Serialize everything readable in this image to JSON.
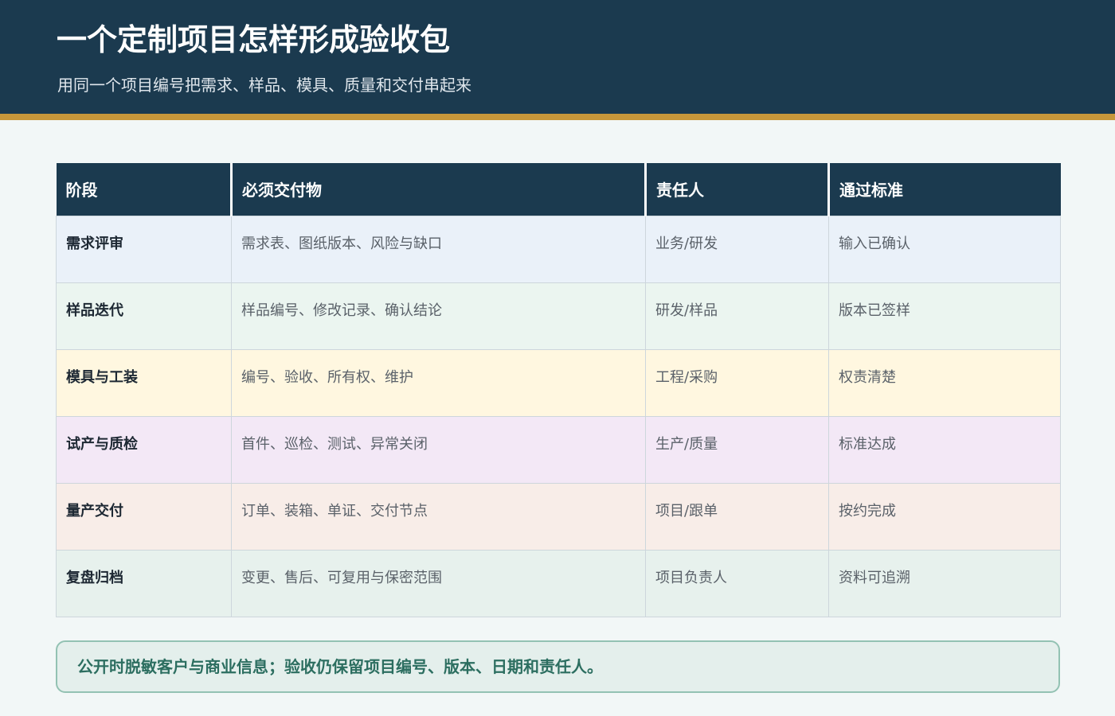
{
  "header": {
    "title": "一个定制项目怎样形成验收包",
    "subtitle": "用同一个项目编号把需求、样品、模具、质量和交付串起来"
  },
  "table": {
    "headers": [
      "阶段",
      "必须交付物",
      "责任人",
      "通过标准"
    ],
    "rows": [
      {
        "stage": "需求评审",
        "deliverables": "需求表、图纸版本、风险与缺口",
        "owner": "业务/研发",
        "criteria": "输入已确认",
        "color": "#eaf1f9"
      },
      {
        "stage": "样品迭代",
        "deliverables": "样品编号、修改记录、确认结论",
        "owner": "研发/样品",
        "criteria": "版本已签样",
        "color": "#ebf5f0"
      },
      {
        "stage": "模具与工装",
        "deliverables": "编号、验收、所有权、维护",
        "owner": "工程/采购",
        "criteria": "权责清楚",
        "color": "#fff7e0"
      },
      {
        "stage": "试产与质检",
        "deliverables": "首件、巡检、测试、异常关闭",
        "owner": "生产/质量",
        "criteria": "标准达成",
        "color": "#f3e8f6"
      },
      {
        "stage": "量产交付",
        "deliverables": "订单、装箱、单证、交付节点",
        "owner": "项目/跟单",
        "criteria": "按约完成",
        "color": "#f8ede8"
      },
      {
        "stage": "复盘归档",
        "deliverables": "变更、售后、可复用与保密范围",
        "owner": "项目负责人",
        "criteria": "资料可追溯",
        "color": "#e7f1ed"
      }
    ]
  },
  "note": {
    "text": "公开时脱敏客户与商业信息；验收仍保留项目编号、版本、日期和责任人。"
  },
  "colors": {
    "header_bg": "#1b3a4f",
    "accent_rule": "#c8973a",
    "note_border": "#93c2b3",
    "note_text": "#2c6e60"
  }
}
